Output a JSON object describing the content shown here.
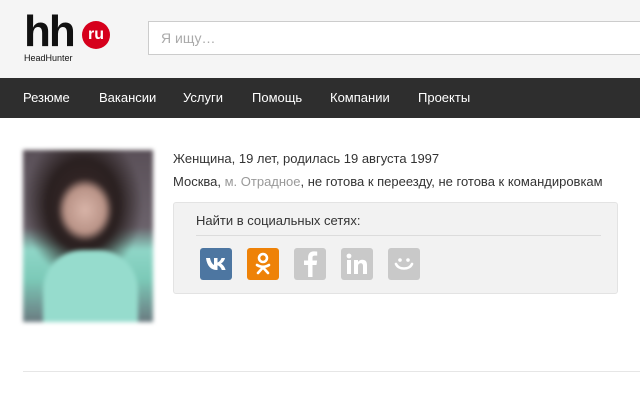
{
  "header": {
    "logo": {
      "main": "hh",
      "badge": "ru",
      "sub": "HeadHunter"
    },
    "search": {
      "placeholder": "Я ищу…",
      "value": ""
    }
  },
  "nav": {
    "items": [
      {
        "label": "Резюме"
      },
      {
        "label": "Вакансии"
      },
      {
        "label": "Услуги"
      },
      {
        "label": "Помощь"
      },
      {
        "label": "Компании"
      },
      {
        "label": "Проекты"
      }
    ]
  },
  "profile": {
    "line1": "Женщина, 19 лет, родилась 19  августа 1997",
    "city": "Москва, ",
    "metro": "м. Отрадное",
    "relocation": ", не готова к переезду, не готова к командировкам"
  },
  "social": {
    "title": "Найти в социальных сетях:",
    "icons": [
      {
        "name": "vk-icon",
        "color": "#4d76a1"
      },
      {
        "name": "odnoklassniki-icon",
        "color": "#ee8208"
      },
      {
        "name": "facebook-icon",
        "color": "#c9c9c9"
      },
      {
        "name": "linkedin-icon",
        "color": "#c9c9c9"
      },
      {
        "name": "moimir-icon",
        "color": "#c9c9c9"
      }
    ]
  }
}
